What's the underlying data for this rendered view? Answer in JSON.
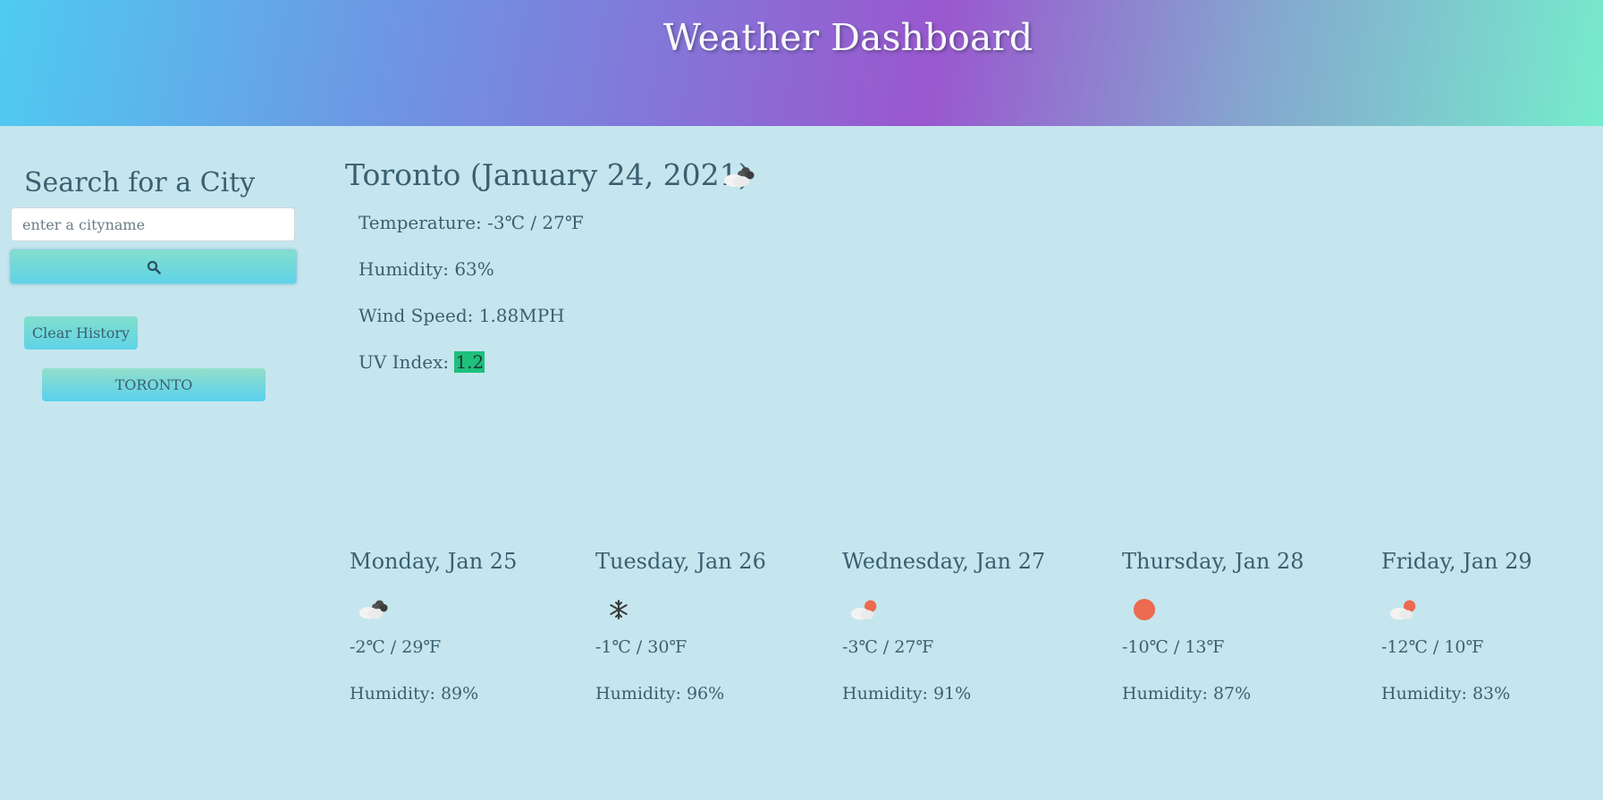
{
  "header": {
    "title": "Weather Dashboard"
  },
  "sidebar": {
    "title": "Search for a City",
    "search_placeholder": "enter a cityname",
    "search_icon": "search-icon",
    "clear_label": "Clear History",
    "history": [
      "TORONTO"
    ]
  },
  "current": {
    "title": "Toronto (January 24, 2021)",
    "icon": "cloudy-icon",
    "temperature": "Temperature: -3℃ / 27℉",
    "humidity": "Humidity: 63%",
    "wind": "Wind Speed: 1.88MPH",
    "uv_label": "UV Index:",
    "uv_value": "1.2",
    "uv_color": "#1fbf7c"
  },
  "forecast": [
    {
      "day": "Monday, Jan 25",
      "icon": "cloudy-icon",
      "temp": "-2℃ / 29℉",
      "humidity": "Humidity: 89%"
    },
    {
      "day": "Tuesday, Jan 26",
      "icon": "snowflake-icon",
      "temp": "-1℃ / 30℉",
      "humidity": "Humidity: 96%"
    },
    {
      "day": "Wednesday, Jan 27",
      "icon": "partly-cloudy-icon",
      "temp": "-3℃ / 27℉",
      "humidity": "Humidity: 91%"
    },
    {
      "day": "Thursday, Jan 28",
      "icon": "sun-icon",
      "temp": "-10℃ / 13℉",
      "humidity": "Humidity: 87%"
    },
    {
      "day": "Friday, Jan 29",
      "icon": "partly-cloudy-icon",
      "temp": "-12℃ / 10℉",
      "humidity": "Humidity: 83%"
    }
  ]
}
